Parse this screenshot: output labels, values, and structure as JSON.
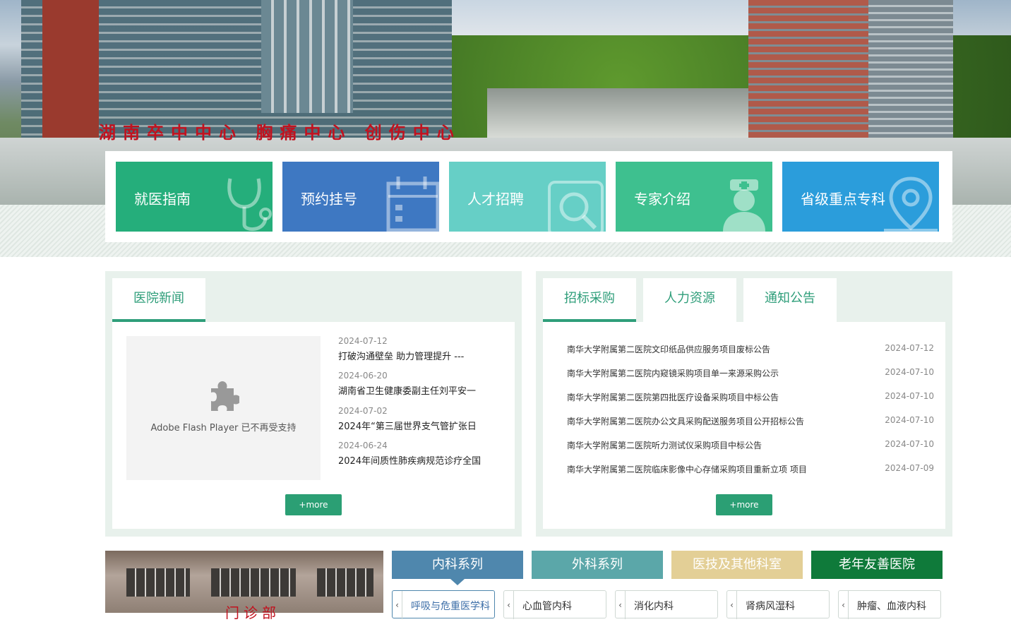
{
  "hero": {
    "sign_text": "湖南卒中中心  胸痛中心  创伤中心"
  },
  "quick_links": [
    {
      "label": "就医指南",
      "icon": "stethoscope-icon",
      "color": "#25ae7b"
    },
    {
      "label": "预约挂号",
      "icon": "calendar-icon",
      "color": "#3e78c2"
    },
    {
      "label": "人才招聘",
      "icon": "magnifier-icon",
      "color": "#66cfc6"
    },
    {
      "label": "专家介绍",
      "icon": "doctor-icon",
      "color": "#3ec08f"
    },
    {
      "label": "省级重点专科",
      "icon": "location-pin-icon",
      "color": "#2b9ddb"
    }
  ],
  "news_panel": {
    "tab": "医院新闻",
    "flash_notice": "Adobe Flash Player 已不再受支持",
    "items": [
      {
        "date": "2024-07-12",
        "title": "打破沟通壁垒 助力管理提升 ---"
      },
      {
        "date": "2024-06-20",
        "title": "湖南省卫生健康委副主任刘平安一"
      },
      {
        "date": "2024-07-02",
        "title": "2024年“第三届世界支气管扩张日"
      },
      {
        "date": "2024-06-24",
        "title": "2024年间质性肺疾病规范诊疗全国"
      }
    ],
    "more": "+more"
  },
  "notice_panel": {
    "tabs": [
      "招标采购",
      "人力资源",
      "通知公告"
    ],
    "items": [
      {
        "title": "南华大学附属第二医院文印纸品供应服务项目废标公告",
        "date": "2024-07-12"
      },
      {
        "title": "南华大学附属第二医院内窥镜采购项目单一来源采购公示",
        "date": "2024-07-10"
      },
      {
        "title": "南华大学附属第二医院第四批医疗设备采购项目中标公告",
        "date": "2024-07-10"
      },
      {
        "title": "南华大学附属第二医院办公文具采购配送服务项目公开招标公告",
        "date": "2024-07-10"
      },
      {
        "title": "南华大学附属第二医院听力测试仪采购项目中标公告",
        "date": "2024-07-10"
      },
      {
        "title": "南华大学附属第二医院临床影像中心存储采购项目重新立项 项目",
        "date": "2024-07-09"
      }
    ],
    "more": "+more"
  },
  "dept_section": {
    "photo_sign": "门诊部",
    "tabs": [
      {
        "label": "内科系列",
        "color": "#4f87ad"
      },
      {
        "label": "外科系列",
        "color": "#5ba7a9"
      },
      {
        "label": "医技及其他科室",
        "color": "#e3cf96"
      },
      {
        "label": "老年友善医院",
        "color": "#0f7a3a"
      }
    ],
    "departments": [
      {
        "name": "呼吸与危重医学科",
        "active": true
      },
      {
        "name": "心血管内科",
        "active": false
      },
      {
        "name": "消化内科",
        "active": false
      },
      {
        "name": "肾病风湿科",
        "active": false
      },
      {
        "name": "肿瘤、血液内科",
        "active": false
      }
    ],
    "chevron": "‹"
  }
}
